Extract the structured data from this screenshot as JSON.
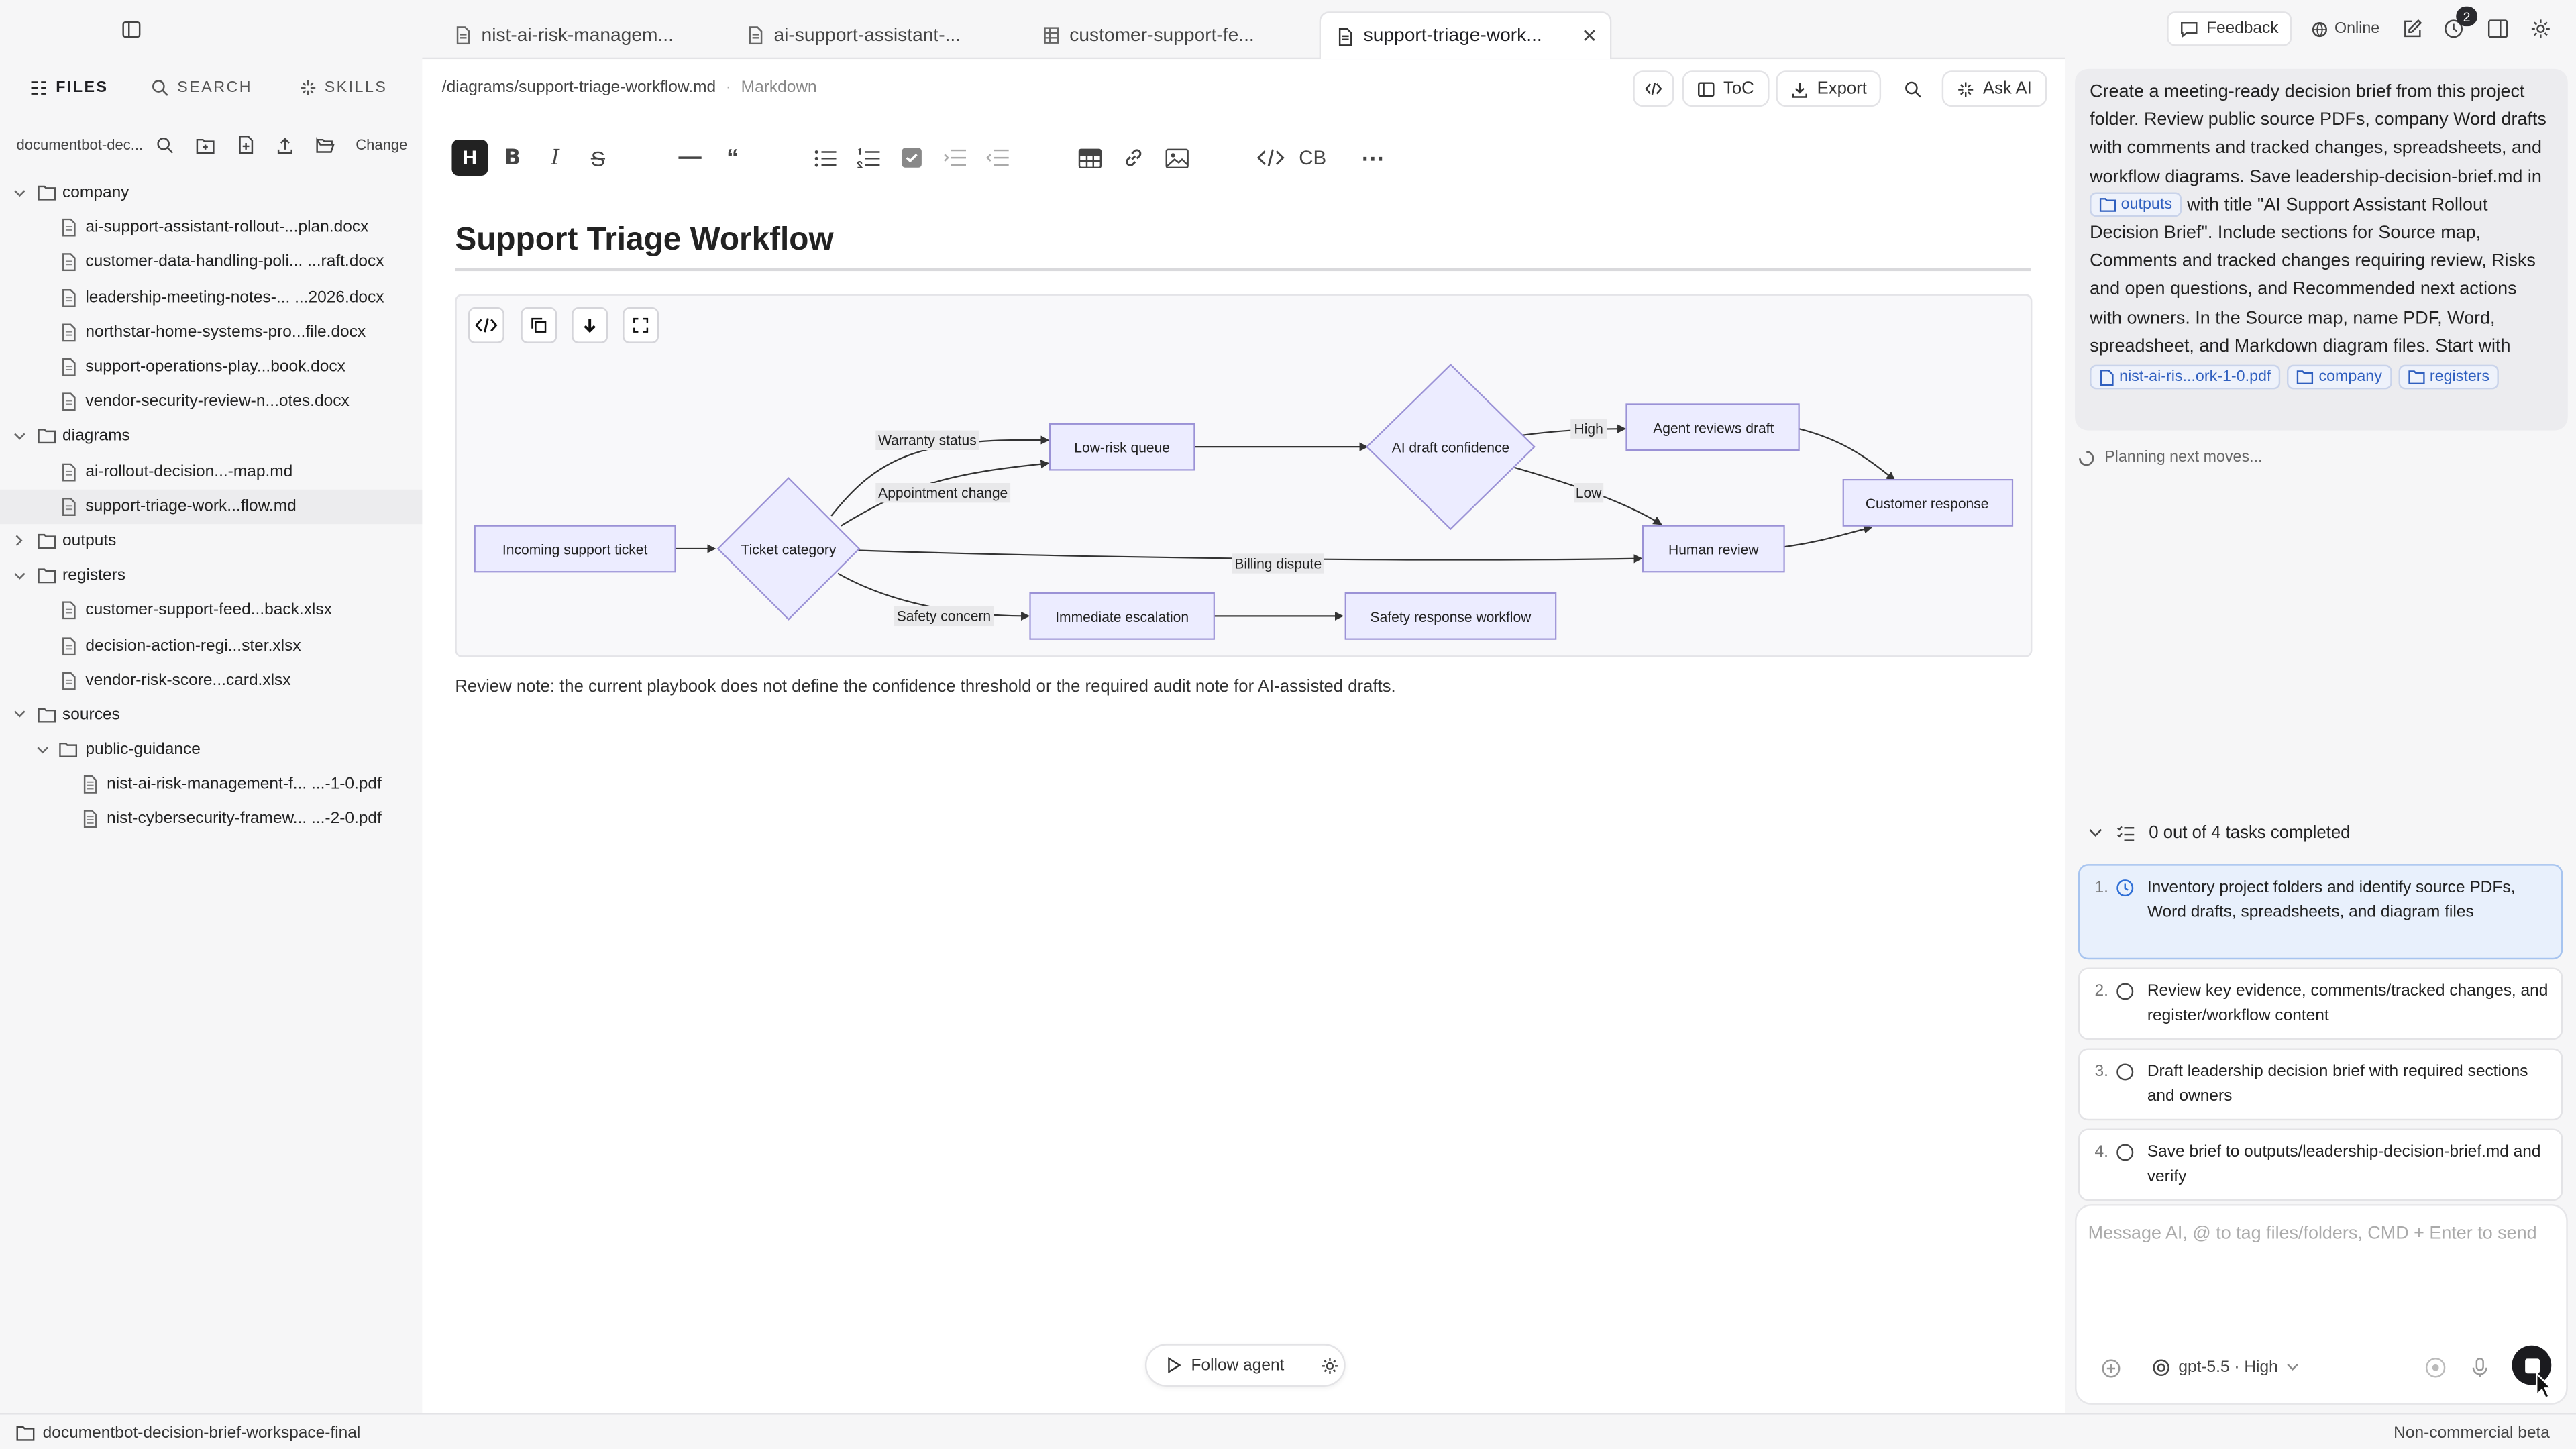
{
  "sidebar": {
    "tabs": [
      {
        "label": "FILES"
      },
      {
        "label": "SEARCH"
      },
      {
        "label": "SKILLS"
      }
    ],
    "path": "documentbot-dec...",
    "change_label": "Change",
    "tree": [
      {
        "label": "company",
        "kind": "folder",
        "expanded": true
      },
      {
        "label": "ai-support-assistant-rollout-...plan.docx",
        "kind": "file"
      },
      {
        "label": "customer-data-handling-poli... ...raft.docx",
        "kind": "file"
      },
      {
        "label": "leadership-meeting-notes-... ...2026.docx",
        "kind": "file"
      },
      {
        "label": "northstar-home-systems-pro...file.docx",
        "kind": "file"
      },
      {
        "label": "support-operations-play...book.docx",
        "kind": "file"
      },
      {
        "label": "vendor-security-review-n...otes.docx",
        "kind": "file"
      },
      {
        "label": "diagrams",
        "kind": "folder",
        "expanded": true
      },
      {
        "label": "ai-rollout-decision...-map.md",
        "kind": "file"
      },
      {
        "label": "support-triage-work...flow.md",
        "kind": "file",
        "selected": true
      },
      {
        "label": "outputs",
        "kind": "folder",
        "expanded": false
      },
      {
        "label": "registers",
        "kind": "folder",
        "expanded": true
      },
      {
        "label": "customer-support-feed...back.xlsx",
        "kind": "file"
      },
      {
        "label": "decision-action-regi...ster.xlsx",
        "kind": "file"
      },
      {
        "label": "vendor-risk-score...card.xlsx",
        "kind": "file"
      },
      {
        "label": "sources",
        "kind": "folder",
        "expanded": true
      },
      {
        "label": "public-guidance",
        "kind": "folder",
        "expanded": true,
        "sub": true
      },
      {
        "label": "nist-ai-risk-management-f... ...-1-0.pdf",
        "kind": "pdf",
        "sub": true
      },
      {
        "label": "nist-cybersecurity-framew... ...-2-0.pdf",
        "kind": "pdf",
        "sub": true
      }
    ]
  },
  "tabs": [
    {
      "label": "nist-ai-risk-managem..."
    },
    {
      "label": "ai-support-assistant-..."
    },
    {
      "label": "customer-support-fe..."
    },
    {
      "label": "support-triage-work...",
      "active": true
    }
  ],
  "topbar": {
    "feedback": "Feedback",
    "online": "Online",
    "badge": "2"
  },
  "editor": {
    "path": "/diagrams/support-triage-workflow.md",
    "mode": "Markdown",
    "toc": "ToC",
    "export": "Export",
    "ask_ai": "Ask AI",
    "heading_btn": "H",
    "cb_label": "CB",
    "title": "Support Triage Workflow",
    "note": "Review note: the current playbook does not define the confidence threshold or the required audit note for AI-assisted drafts.",
    "follow": "Follow agent"
  },
  "diagram": {
    "nodes": {
      "incoming": "Incoming support ticket",
      "category": "Ticket category",
      "lowrisk": "Low-risk queue",
      "confidence": "AI draft confidence",
      "agent": "Agent reviews draft",
      "customer": "Customer response",
      "human": "Human review",
      "escalation": "Immediate escalation",
      "safety": "Safety response workflow"
    },
    "edges": {
      "warranty": "Warranty status",
      "appointment": "Appointment change",
      "billing": "Billing dispute",
      "safety": "Safety concern",
      "high": "High",
      "low": "Low"
    }
  },
  "chat": {
    "message_parts": [
      "Create a meeting-ready decision brief from this project folder. Review public source PDFs, company Word drafts with comments and tracked changes, spreadsheets, and workflow diagrams. Save leadership-decision-brief.md in ",
      " with title \"AI Support Assistant Rollout Decision Brief\". Include sections for Source map, Comments and tracked changes requiring review, Risks and open questions, and Recommended next actions with owners. In the Source map, name PDF, Word, spreadsheet, and Markdown diagram files. Start with "
    ],
    "chips": {
      "outputs": "outputs",
      "pdf": "nist-ai-ris...ork-1-0.pdf",
      "company": "company",
      "registers": "registers"
    },
    "planning": "Planning next moves...",
    "tasks_header": "0 out of 4 tasks completed",
    "tasks": [
      {
        "num": "1.",
        "text": "Inventory project folders and identify source PDFs, Word drafts, spreadsheets, and diagram files"
      },
      {
        "num": "2.",
        "text": "Review key evidence, comments/tracked changes, and register/workflow content"
      },
      {
        "num": "3.",
        "text": "Draft leadership decision brief with required sections and owners"
      },
      {
        "num": "4.",
        "text": "Save brief to outputs/leadership-decision-brief.md and verify"
      }
    ],
    "placeholder": "Message AI, @ to tag files/folders, CMD + Enter to send",
    "model": "gpt-5.5 · High"
  },
  "status": {
    "workspace": "documentbot-decision-brief-workspace-final",
    "beta": "Non-commercial beta"
  }
}
